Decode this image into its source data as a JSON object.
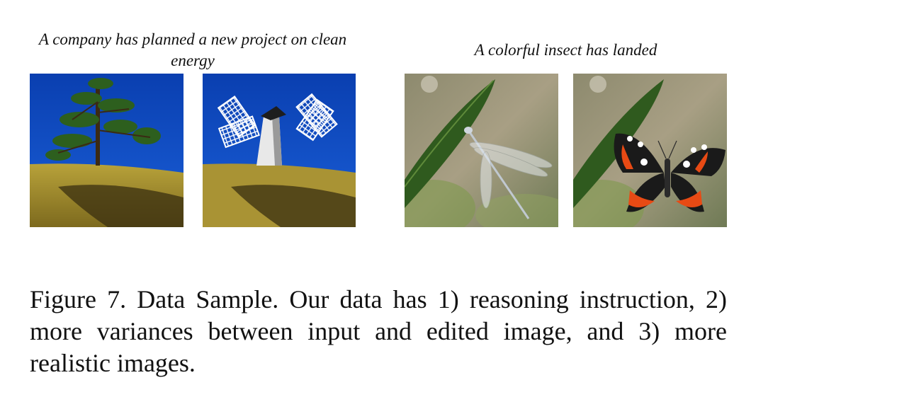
{
  "figure": {
    "pairs": [
      {
        "instruction": "A company has planned a new project on clean energy",
        "input_image": "pine tree on a grassy hill under a blue sky",
        "edited_image": "windmill on a grassy hill under a blue sky"
      },
      {
        "instruction": "A colorful insect has landed",
        "input_image": "damselfly resting on a green leaf",
        "edited_image": "red admiral butterfly on a green leaf"
      }
    ],
    "caption": "Figure 7.  Data Sample.  Our data has 1) reasoning instruction, 2) more variances between input and edited image, and 3) more realistic images."
  }
}
